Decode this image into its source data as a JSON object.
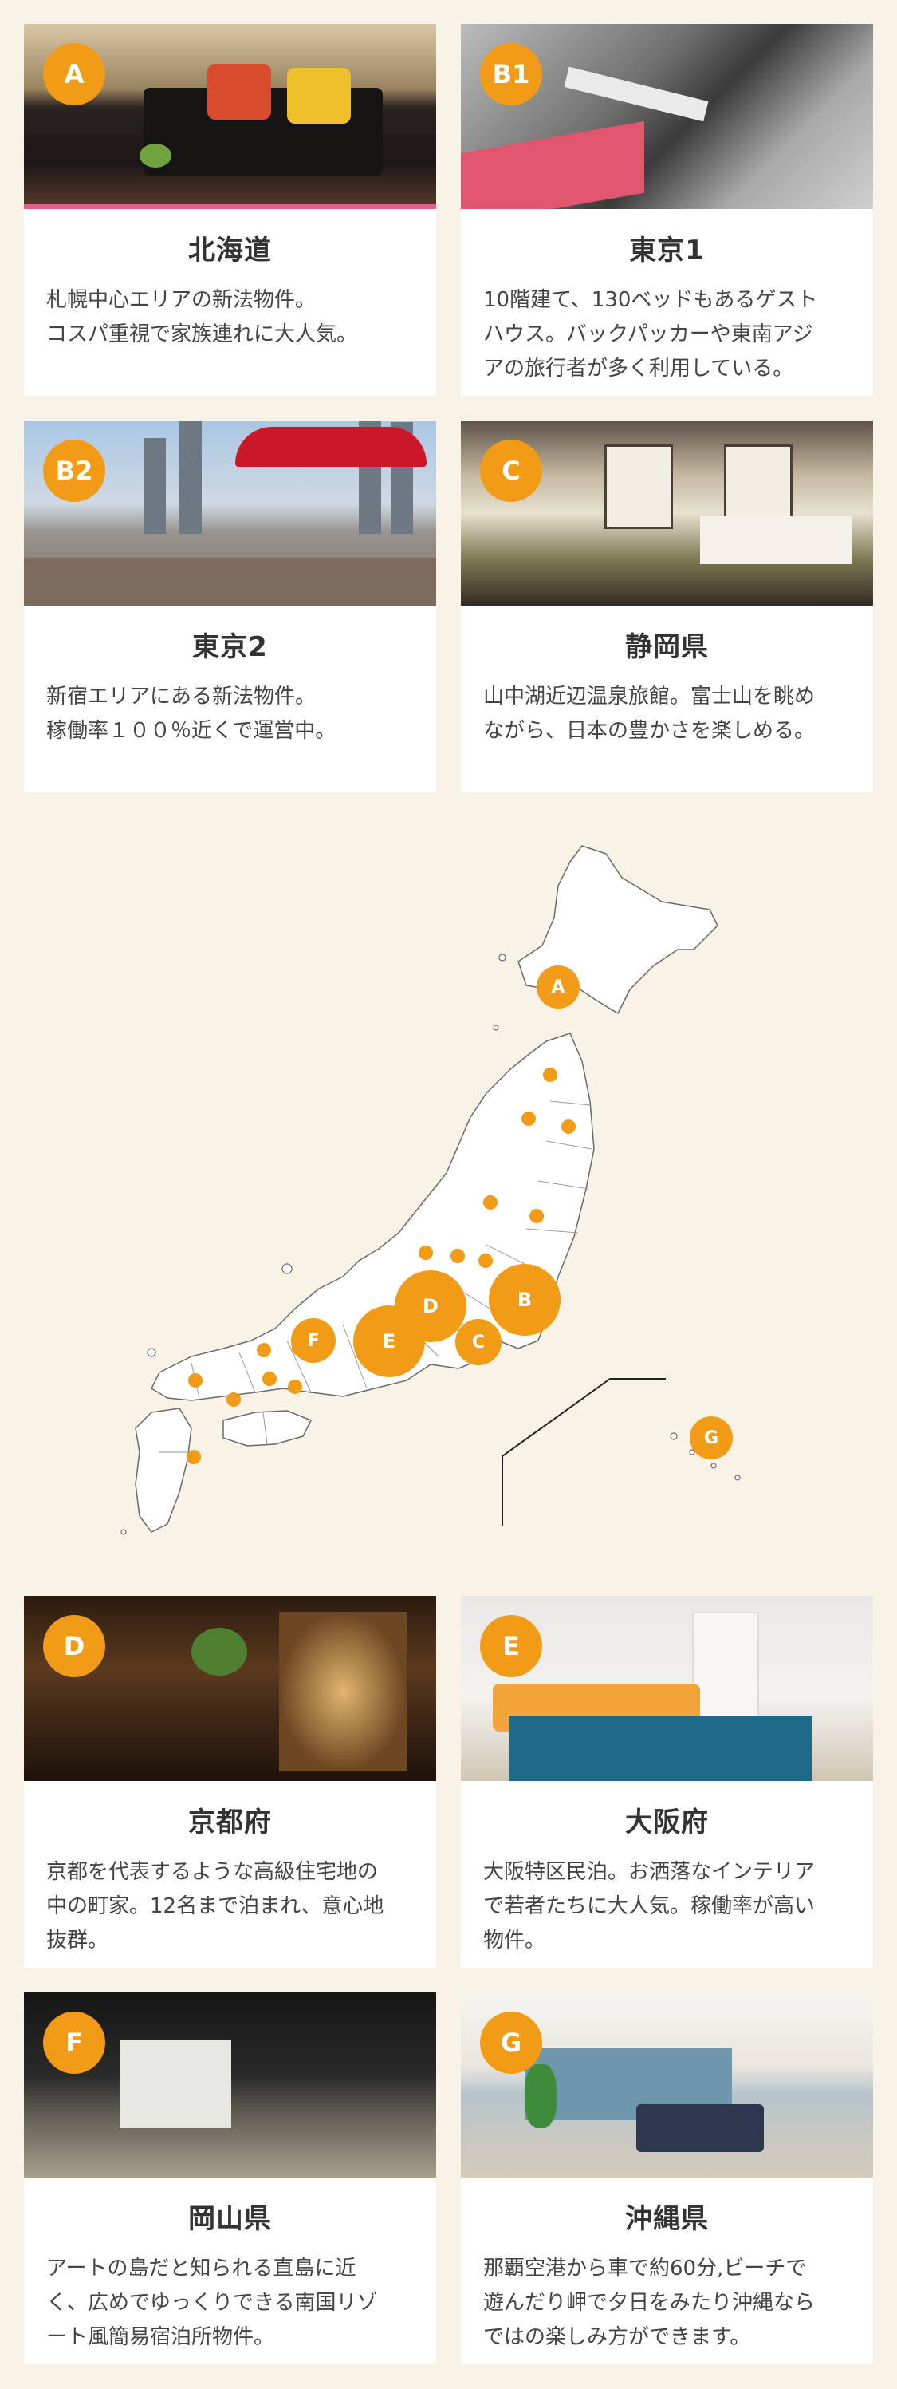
{
  "accent_color": "#f29b16",
  "top_cards": [
    {
      "badge": "A",
      "title": "北海道",
      "desc": "札幌中心エリアの新法物件。\nコスパ重視で家族連れに大人気。"
    },
    {
      "badge": "B1",
      "title": "東京1",
      "desc": "10階建て、130ベッドもあるゲスト\nハウス。バックパッカーや東南アジ\nアの旅行者が多く利用している。"
    },
    {
      "badge": "B2",
      "title": "東京2",
      "desc": "新宿エリアにある新法物件。\n稼働率１００％近くで運営中。"
    },
    {
      "badge": "C",
      "title": "静岡県",
      "desc": "山中湖近辺温泉旅館。富士山を眺め\nながら、日本の豊かさを楽しめる。"
    }
  ],
  "map": {
    "markers": [
      "A",
      "B",
      "C",
      "D",
      "E",
      "F",
      "G"
    ]
  },
  "bottom_cards": [
    {
      "badge": "D",
      "title": "京都府",
      "desc": "京都を代表するような高級住宅地の\n中の町家。12名まで泊まれ、意心地\n抜群。"
    },
    {
      "badge": "E",
      "title": "大阪府",
      "desc": "大阪特区民泊。お洒落なインテリア\nで若者たちに大人気。稼働率が高い\n物件。"
    },
    {
      "badge": "F",
      "title": "岡山県",
      "desc": "アートの島だと知られる直島に近\nく、広めでゆっくりできる南国リゾ\nート風簡易宿泊所物件。"
    },
    {
      "badge": "G",
      "title": "沖縄県",
      "desc": "那覇空港から車で約60分,ビーチで\n遊んだり岬で夕日をみたり沖縄なら\nではの楽しみ方ができます。"
    }
  ]
}
